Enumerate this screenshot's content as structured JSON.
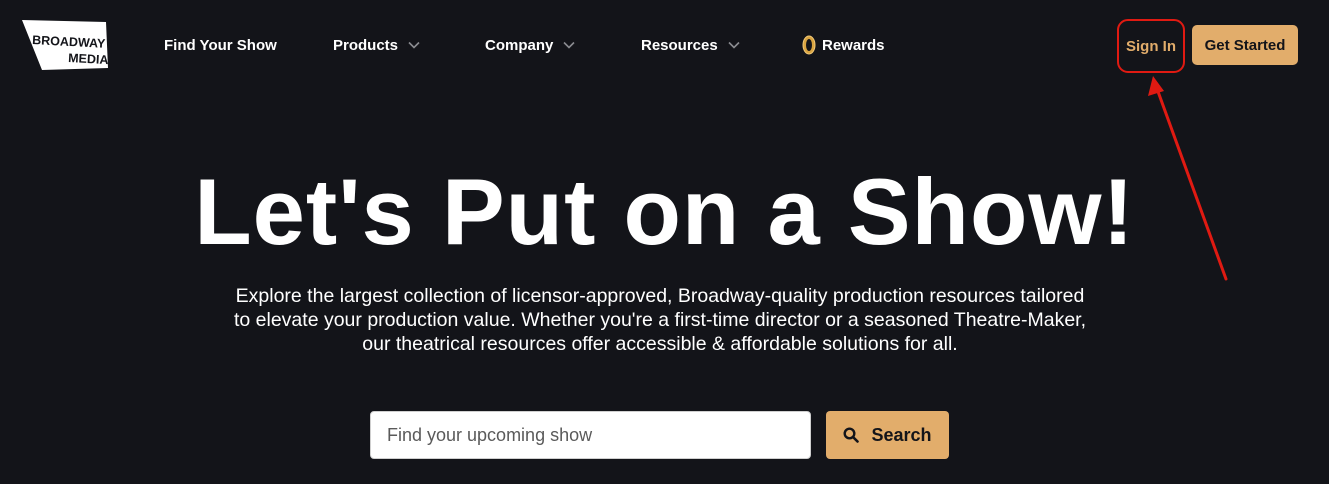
{
  "nav": {
    "logo_line1": "BROADWAY",
    "logo_line2": "MEDIA",
    "find_your_show": "Find Your Show",
    "products": "Products",
    "company": "Company",
    "resources": "Resources",
    "rewards": "Rewards",
    "rewards_icon": "gold-zero-coin-icon",
    "dropdown_icon": "chevron-down-icon",
    "sign_in": "Sign In",
    "get_started": "Get Started"
  },
  "hero": {
    "title": "Let's Put on a Show!",
    "subtitle": "Explore the largest collection of licensor-approved, Broadway-quality production resources tailored to elevate your production value. Whether you're a first-time director or a seasoned Theatre-Maker, our theatrical resources offer accessible & affordable solutions for all."
  },
  "search": {
    "placeholder": "Find your upcoming show",
    "value": "",
    "button_label": "Search",
    "button_icon": "search-icon"
  },
  "colors": {
    "background": "#131419",
    "accent": "#e2ad6b",
    "highlight_annotation": "#e01a12",
    "text": "#ffffff"
  }
}
